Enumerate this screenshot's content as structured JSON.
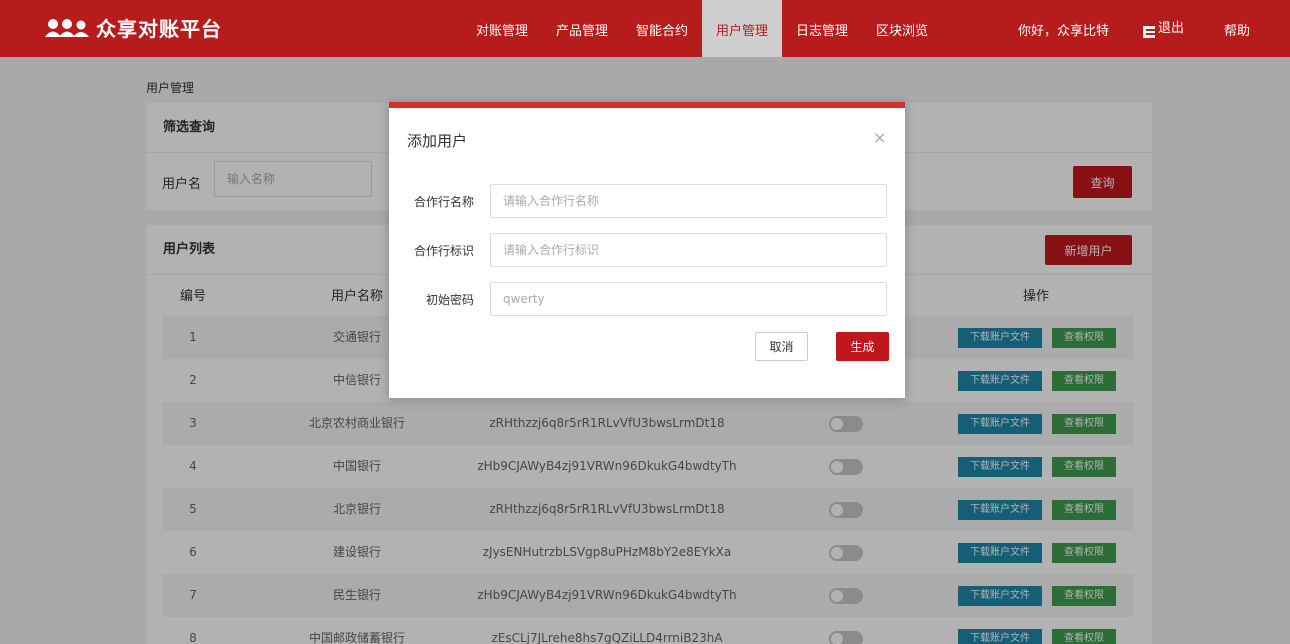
{
  "header": {
    "logo_text": "众享对账平台",
    "nav": [
      "对账管理",
      "产品管理",
      "智能合约",
      "用户管理",
      "日志管理",
      "区块浏览"
    ],
    "active_nav": "用户管理",
    "greeting": "你好，众享比特",
    "logout": "退出",
    "help": "帮助"
  },
  "breadcrumb": "用户管理",
  "filter": {
    "title": "筛选查询",
    "username_label": "用户名",
    "username_placeholder": "输入名称",
    "query_button": "查询"
  },
  "list": {
    "title": "用户列表",
    "add_button": "新增用户",
    "columns": [
      "编号",
      "用户名称",
      "操作"
    ],
    "rows": [
      {
        "id": "1",
        "name": "交通银行",
        "key": ""
      },
      {
        "id": "2",
        "name": "中信银行",
        "key": ""
      },
      {
        "id": "3",
        "name": "北京农村商业银行",
        "key": "zRHthzzj6q8r5rR1RLvVfU3bwsLrmDt18"
      },
      {
        "id": "4",
        "name": "中国银行",
        "key": "zHb9CJAWyB4zj91VRWn96DkukG4bwdtyTh"
      },
      {
        "id": "5",
        "name": "北京银行",
        "key": "zRHthzzj6q8r5rR1RLvVfU3bwsLrmDt18"
      },
      {
        "id": "6",
        "name": "建设银行",
        "key": "zJysENHutrzbLSVgp8uPHzM8bY2e8EYkXa"
      },
      {
        "id": "7",
        "name": "民生银行",
        "key": "zHb9CJAWyB4zj91VRWn96DkukG4bwdtyTh"
      },
      {
        "id": "8",
        "name": "中国邮政储蓄银行",
        "key": "zEsCLj7JLrehe8hs7gQZiLLD4rrniB23hA"
      }
    ],
    "download_button": "下载账户文件",
    "permission_button": "查看权限"
  },
  "modal": {
    "title": "添加用户",
    "close": "×",
    "fields": [
      {
        "label": "合作行名称",
        "placeholder": "请输入合作行名称",
        "value": ""
      },
      {
        "label": "合作行标识",
        "placeholder": "请输入合作行标识",
        "value": ""
      },
      {
        "label": "初始密码",
        "placeholder": "qwerty",
        "value": ""
      }
    ],
    "cancel_button": "取消",
    "generate_button": "生成"
  },
  "colors": {
    "brand_red": "#b71c1c",
    "button_red": "#c0171d",
    "download_blue": "#1e88a8",
    "permission_green": "#3f9b4f"
  }
}
